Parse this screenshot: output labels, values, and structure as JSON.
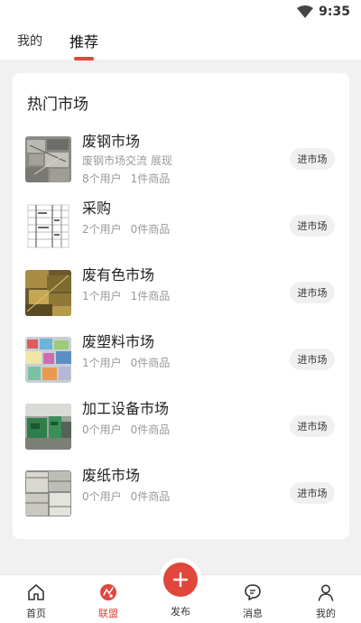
{
  "status_bar": {
    "time": "9:35"
  },
  "top_tabs": [
    {
      "label": "我的",
      "active": false
    },
    {
      "label": "推荐",
      "active": true
    }
  ],
  "card": {
    "title": "热门市场"
  },
  "markets": [
    {
      "name": "废钢市场",
      "desc": "废钢市场交流 展现",
      "users": "8个用户",
      "goods": "1件商品",
      "button": "进市场",
      "thumb": "scrap-steel"
    },
    {
      "name": "采购",
      "desc": "",
      "users": "2个用户",
      "goods": "0件商品",
      "button": "进市场",
      "thumb": "document"
    },
    {
      "name": "废有色市场",
      "desc": "",
      "users": "1个用户",
      "goods": "1件商品",
      "button": "进市场",
      "thumb": "nonferrous"
    },
    {
      "name": "废塑料市场",
      "desc": "",
      "users": "1个用户",
      "goods": "0件商品",
      "button": "进市场",
      "thumb": "plastic"
    },
    {
      "name": "加工设备市场",
      "desc": "",
      "users": "0个用户",
      "goods": "0件商品",
      "button": "进市场",
      "thumb": "equipment"
    },
    {
      "name": "废纸市场",
      "desc": "",
      "users": "0个用户",
      "goods": "0件商品",
      "button": "进市场",
      "thumb": "paper"
    }
  ],
  "bottom_nav": {
    "home": "首页",
    "alliance": "联盟",
    "publish": "发布",
    "messages": "消息",
    "mine": "我的"
  },
  "colors": {
    "accent": "#e0463a"
  }
}
